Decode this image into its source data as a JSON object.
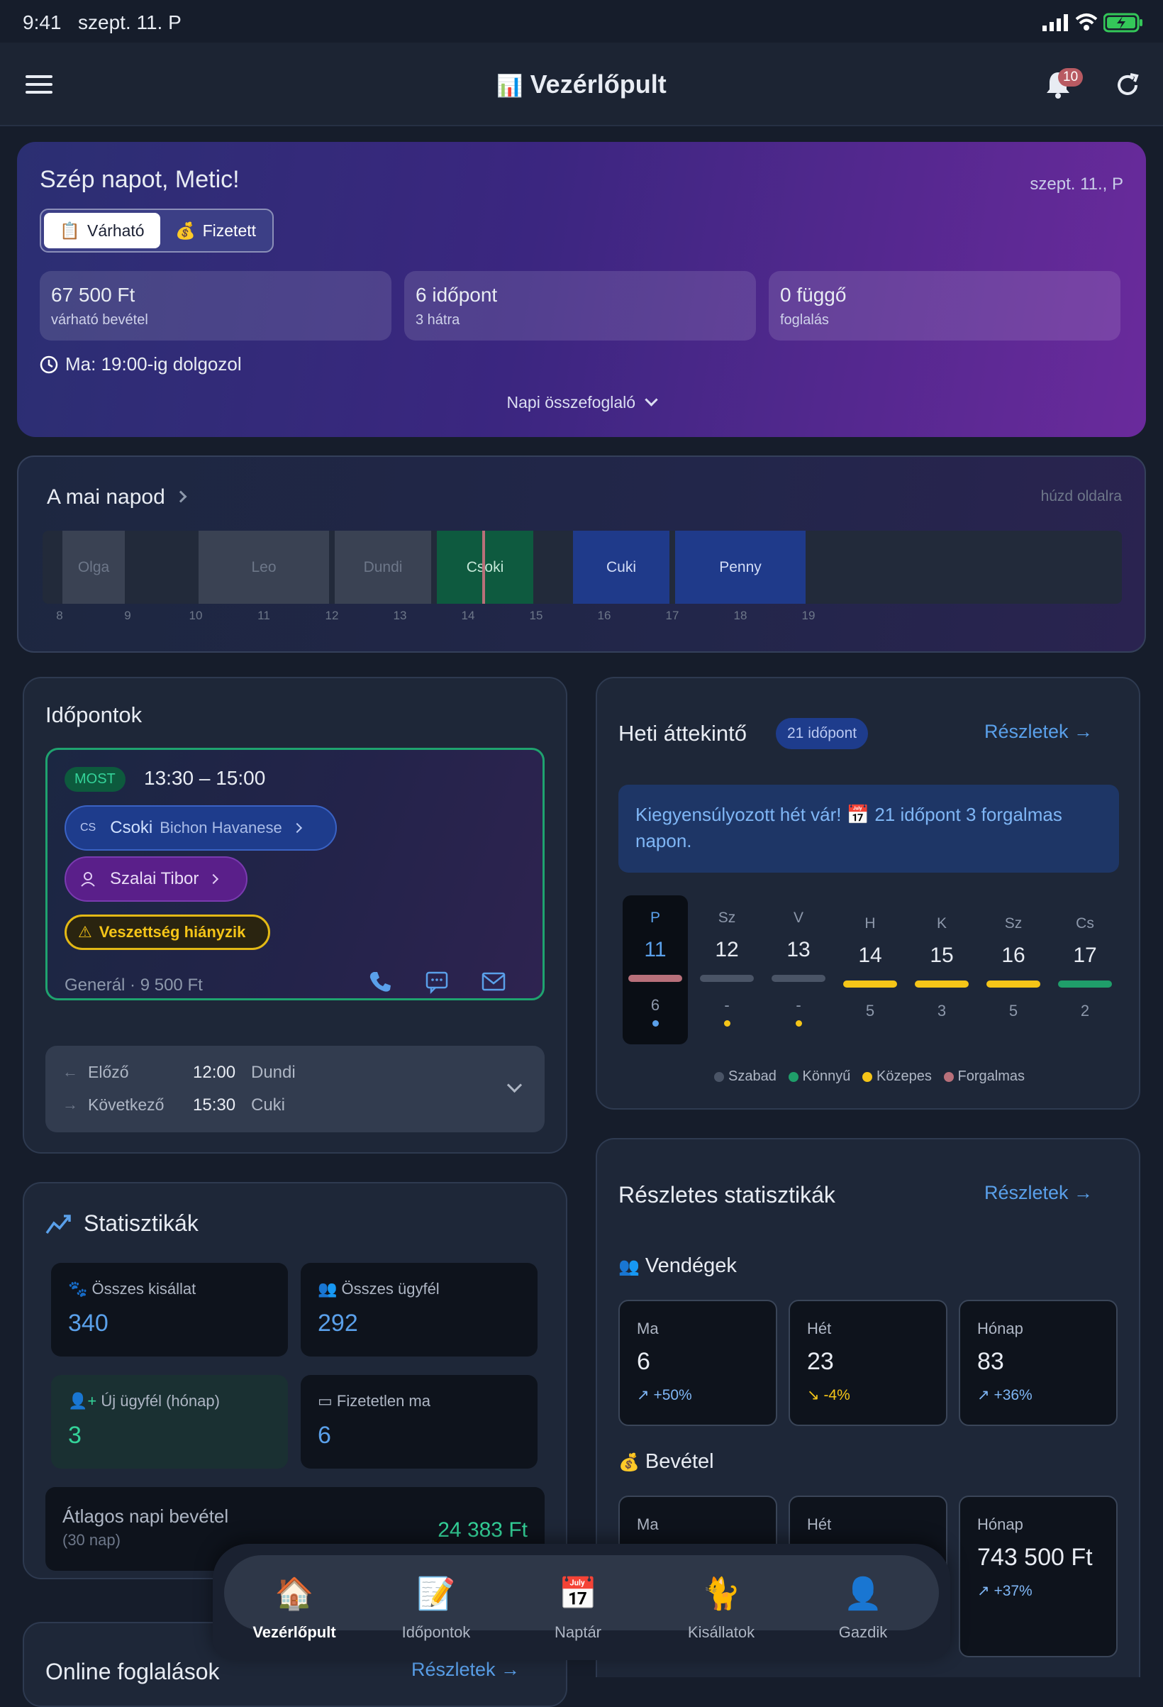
{
  "status_bar": {
    "time": "9:41",
    "date": "szept. 11. P"
  },
  "header": {
    "icon": "bar-chart-icon",
    "title": "Vezérlőpult",
    "notif_count": "10"
  },
  "hero": {
    "greeting": "Szép napot, Metic!",
    "date": "szept. 11., P",
    "toggle": {
      "active": "Várható",
      "inactive": "Fizetett"
    },
    "stats": [
      {
        "value": "67 500 Ft",
        "label": "várható bevétel"
      },
      {
        "value": "6 időpont",
        "label": "3 hátra"
      },
      {
        "value": "0 függő",
        "label": "foglalás"
      }
    ],
    "work_note": "Ma: 19:00-ig dolgozol",
    "summary": "Napi összefoglaló"
  },
  "today": {
    "title": "A mai napod",
    "hint": "húzd oldalra",
    "blocks": [
      "Olga",
      "Leo",
      "Dundi",
      "Csoki",
      "Cuki",
      "Penny"
    ],
    "hours": [
      "8",
      "9",
      "10",
      "11",
      "12",
      "13",
      "14",
      "15",
      "16",
      "17",
      "18",
      "19"
    ]
  },
  "appointments": {
    "title": "Időpontok",
    "now_badge": "MOST",
    "time_range": "13:30 – 15:00",
    "pet_initials": "CS",
    "pet_name": "Csoki",
    "pet_breed": "Bichon Havanese",
    "owner": "Szalai Tibor",
    "warning": "Veszettség hiányzik",
    "service": "Generál · 9 500 Ft",
    "prev": {
      "label": "Előző",
      "time": "12:00",
      "name": "Dundi"
    },
    "next": {
      "label": "Következő",
      "time": "15:30",
      "name": "Cuki"
    }
  },
  "weekly": {
    "title": "Heti áttekintő",
    "badge": "21 időpont",
    "details": "Részletek →",
    "banner": "Kiegyensúlyozott hét vár! 📅 21 időpont 3 forgalmas napon.",
    "days": [
      {
        "name": "P",
        "num": "11",
        "count": "6",
        "color": "#b8707a"
      },
      {
        "name": "Sz",
        "num": "12",
        "count": "-",
        "color": "#4a5466"
      },
      {
        "name": "V",
        "num": "13",
        "count": "-",
        "color": "#4a5466"
      },
      {
        "name": "H",
        "num": "14",
        "count": "5",
        "color": "#f5c518"
      },
      {
        "name": "K",
        "num": "15",
        "count": "3",
        "color": "#f5c518"
      },
      {
        "name": "Sz",
        "num": "16",
        "count": "5",
        "color": "#f5c518"
      },
      {
        "name": "Cs",
        "num": "17",
        "count": "2",
        "color": "#1f9e6a"
      }
    ],
    "legend": [
      {
        "label": "Szabad",
        "color": "#4a5466"
      },
      {
        "label": "Könnyű",
        "color": "#1f9e6a"
      },
      {
        "label": "Közepes",
        "color": "#f5c518"
      },
      {
        "label": "Forgalmas",
        "color": "#b8707a"
      }
    ]
  },
  "stats": {
    "title": "Statisztikák",
    "items": [
      {
        "label": "Összes kisállat",
        "value": "340"
      },
      {
        "label": "Összes ügyfél",
        "value": "292"
      },
      {
        "label": "Új ügyfél (hónap)",
        "value": "3"
      },
      {
        "label": "Fizetetlen ma",
        "value": "6"
      }
    ],
    "avg_label": "Átlagos napi bevétel",
    "avg_sub": "(30 nap)",
    "avg_value": "24 383 Ft"
  },
  "detailed": {
    "title": "Részletes statisztikák",
    "details": "Részletek →",
    "guests": {
      "title": "Vendégek",
      "cells": [
        {
          "label": "Ma",
          "value": "6",
          "trend": "+50%"
        },
        {
          "label": "Hét",
          "value": "23",
          "trend": "-4%"
        },
        {
          "label": "Hónap",
          "value": "83",
          "trend": "+36%"
        }
      ]
    },
    "revenue": {
      "title": "Bevétel",
      "cells": [
        {
          "label": "Ma"
        },
        {
          "label": "Hét"
        },
        {
          "label": "Hónap",
          "value": "743 500 Ft",
          "trend": "+37%"
        }
      ]
    }
  },
  "bottom_nav": [
    {
      "label": "Vezérlőpult",
      "icon": "🏠"
    },
    {
      "label": "Időpontok",
      "icon": "📝"
    },
    {
      "label": "Naptár",
      "icon": "📅"
    },
    {
      "label": "Kisállatok",
      "icon": "🐈"
    },
    {
      "label": "Gazdik",
      "icon": "👤"
    }
  ],
  "partial_card": {
    "title": "Online foglalások",
    "link": "Részletek →"
  }
}
